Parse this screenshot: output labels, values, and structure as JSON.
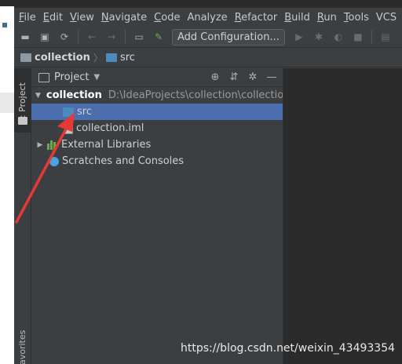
{
  "menu": {
    "items": [
      {
        "first": "F",
        "rest": "ile"
      },
      {
        "first": "E",
        "rest": "dit"
      },
      {
        "first": "V",
        "rest": "iew"
      },
      {
        "first": "N",
        "rest": "avigate"
      },
      {
        "first": "C",
        "rest": "ode"
      },
      {
        "first": "",
        "rest": "Analyze"
      },
      {
        "first": "R",
        "rest": "efactor"
      },
      {
        "first": "B",
        "rest": "uild"
      },
      {
        "first": "R",
        "rest": "un"
      },
      {
        "first": "T",
        "rest": "ools"
      },
      {
        "first": "",
        "rest": "VCS"
      }
    ]
  },
  "toolbar": {
    "add_configuration_label": "Add Configuration..."
  },
  "navbar": {
    "project": "collection",
    "folder": "src"
  },
  "stripe": {
    "project_tab": "1: Project",
    "favorites_tab": "avorites"
  },
  "panel": {
    "title": "Project"
  },
  "tree": {
    "root_label": "collection",
    "root_path": "D:\\IdeaProjects\\collection\\collection",
    "src_label": "src",
    "iml_label": "collection.iml",
    "libs_label": "External Libraries",
    "scratches_label": "Scratches and Consoles"
  },
  "watermark": "https://blog.csdn.net/weixin_43493354",
  "colors": {
    "selection": "#4b6eaf",
    "annotation_arrow": "#e53935"
  }
}
